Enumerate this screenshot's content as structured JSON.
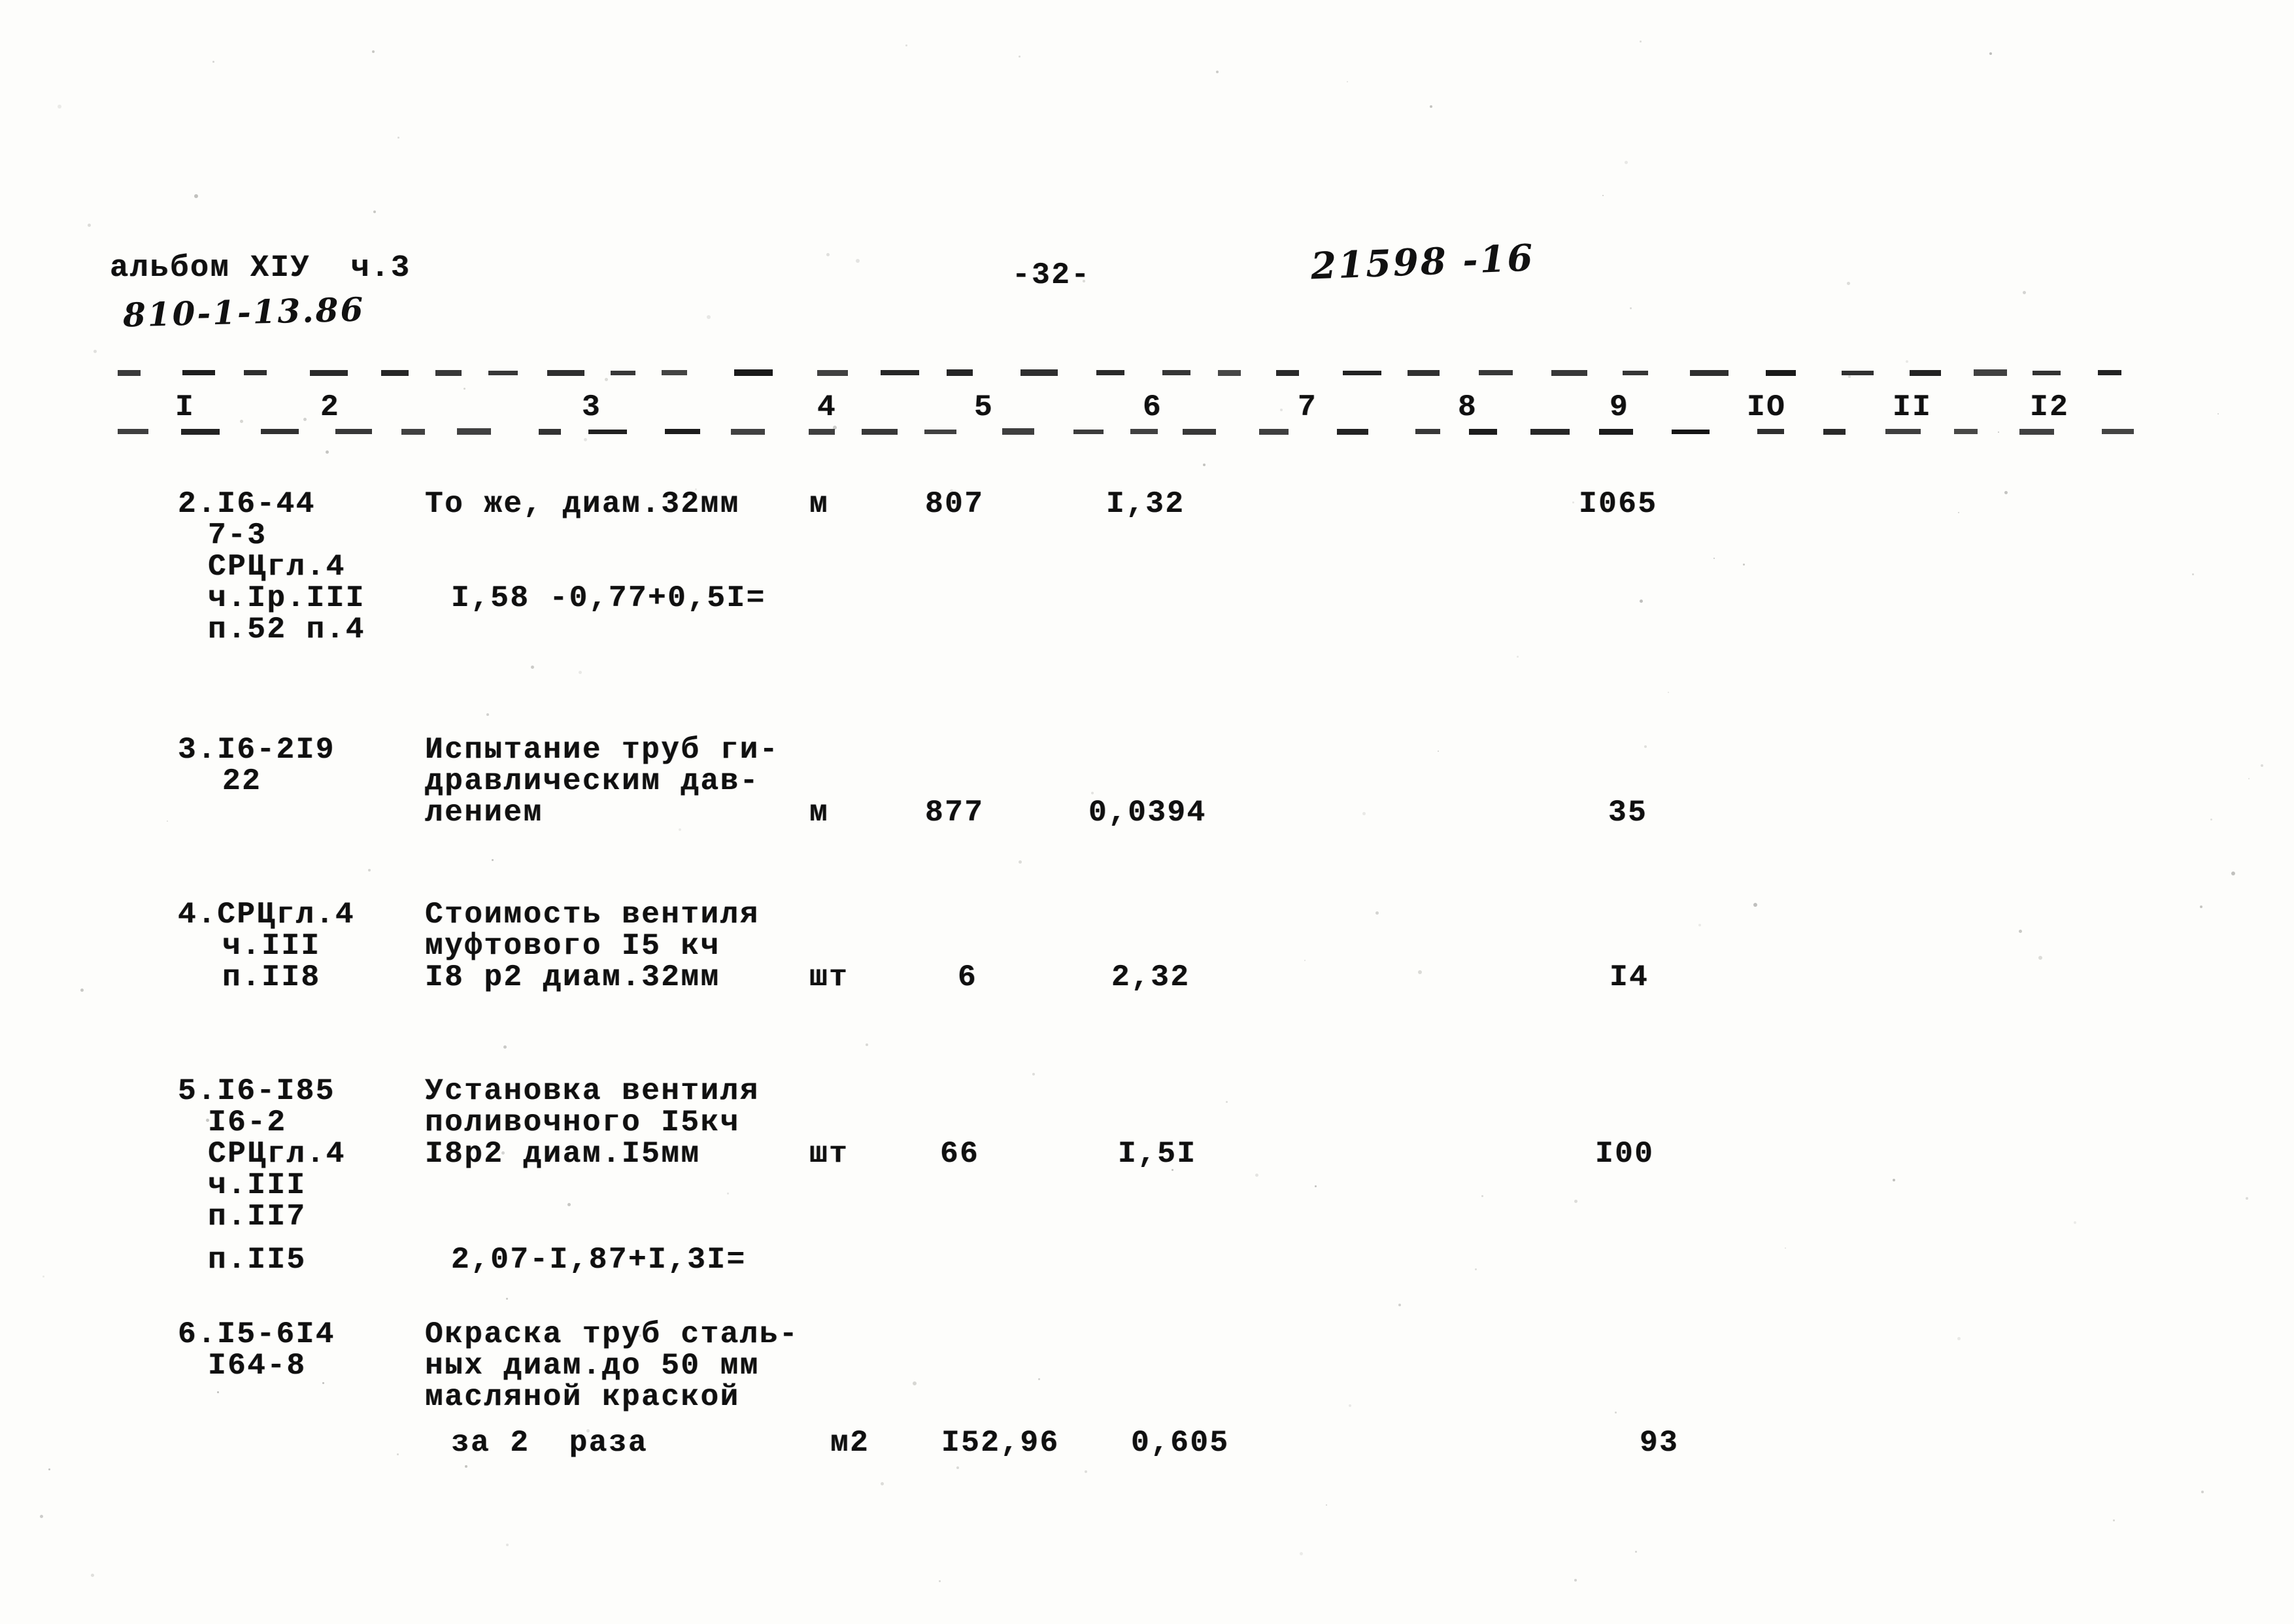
{
  "header": {
    "album": "альбом XIУ  ч.3",
    "doc_code": "810-1-13.86",
    "page_number": "-32-",
    "stamp_code": "21598 -16"
  },
  "table": {
    "column_numbers": [
      "I",
      "2",
      "3",
      "4",
      "5",
      "6",
      "7",
      "8",
      "9",
      "IO",
      "II",
      "I2"
    ],
    "rows": [
      {
        "position_lines": [
          "2.I6-44",
          "7-3",
          "СРЦгл.4",
          "ч.Iр.III",
          "п.52 п.4"
        ],
        "description_lines": [
          "То же, диам.32мм"
        ],
        "formula": "I,58 -0,77+0,5I=",
        "unit": "м",
        "quantity": "807",
        "price": "I,32",
        "col7": "",
        "col8": "",
        "total": "I065"
      },
      {
        "position_lines": [
          "3.I6-2I9",
          "22"
        ],
        "description_lines": [
          "Испытание труб ги-",
          "дравлическим дав-",
          "лением"
        ],
        "formula": "",
        "unit": "м",
        "quantity": "877",
        "price": "0,0394",
        "col7": "",
        "col8": "",
        "total": "35"
      },
      {
        "position_lines": [
          "4.СРЦгл.4",
          "ч.III",
          "п.II8"
        ],
        "description_lines": [
          "Стоимость вентиля",
          "муфтового I5 кч",
          "I8 р2 диам.32мм"
        ],
        "formula": "",
        "unit": "шт",
        "quantity": "6",
        "price": "2,32",
        "col7": "",
        "col8": "",
        "total": "I4"
      },
      {
        "position_lines": [
          "5.I6-I85",
          "I6-2",
          "СРЦгл.4",
          "ч.III",
          "п.II7",
          "п.II5"
        ],
        "description_lines": [
          "Установка вентиля",
          "поливочного I5кч",
          "I8р2 диам.I5мм"
        ],
        "formula": "2,07-I,87+I,3I=",
        "unit": "шт",
        "quantity": "66",
        "price": "I,5I",
        "col7": "",
        "col8": "",
        "total": "I00"
      },
      {
        "position_lines": [
          "6.I5-6I4",
          "I64-8"
        ],
        "description_lines": [
          "Окраска труб сталь-",
          "ных диам.до 50 мм",
          "масляной краской",
          "за 2  раза"
        ],
        "formula": "",
        "unit": "м2",
        "quantity": "I52,96",
        "price": "0,605",
        "col7": "",
        "col8": "",
        "total": "93"
      }
    ]
  }
}
